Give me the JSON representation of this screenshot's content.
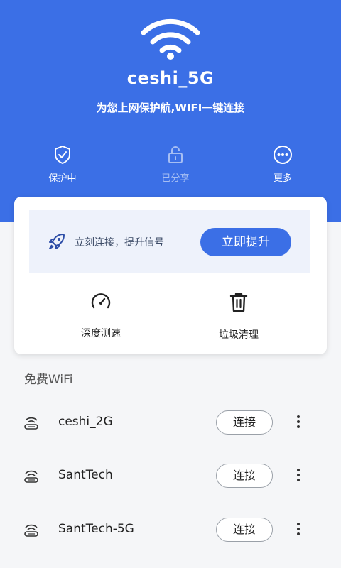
{
  "header": {
    "ssid": "ceshi_5G",
    "tagline": "为您上网保护航,WIFI一键连接",
    "bg_color": "#3b6fe6",
    "actions": [
      {
        "label": "保护中",
        "icon": "shield-check-icon"
      },
      {
        "label": "已分享",
        "icon": "unlock-icon"
      },
      {
        "label": "更多",
        "icon": "more-dots-icon"
      }
    ]
  },
  "boost_card": {
    "text": "立刻连接，提升信号",
    "button_label": "立即提升",
    "tools": [
      {
        "label": "深度测速",
        "icon": "speedometer-icon"
      },
      {
        "label": "垃圾清理",
        "icon": "trash-icon"
      }
    ]
  },
  "free_wifi": {
    "title": "免费WiFi",
    "networks": [
      {
        "name": "ceshi_2G",
        "action": "连接"
      },
      {
        "name": "SantTech",
        "action": "连接"
      },
      {
        "name": "SantTech-5G",
        "action": "连接"
      }
    ]
  }
}
